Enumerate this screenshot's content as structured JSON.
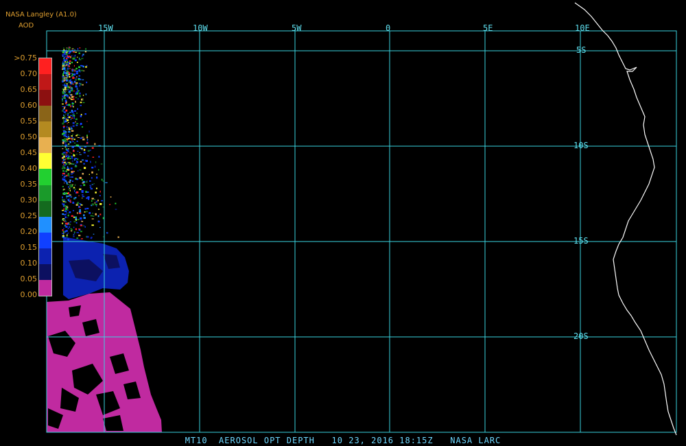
{
  "header": {
    "source": "NASA Langley (A1.0)",
    "product": "AOD"
  },
  "legend": {
    "labels": [
      ">0.75",
      "0.70",
      "0.65",
      "0.60",
      "0.55",
      "0.50",
      "0.45",
      "0.40",
      "0.35",
      "0.30",
      "0.25",
      "0.20",
      "0.15",
      "0.10",
      "0.05",
      "0.00"
    ],
    "colors": [
      "#ff2020",
      "#c01818",
      "#8c1010",
      "#8a6418",
      "#b48a20",
      "#e8b050",
      "#ffff33",
      "#22d030",
      "#1a9a2a",
      "#146a1e",
      "#2090ff",
      "#1040ff",
      "#0c22b0",
      "#0c1060",
      "#c02aa0"
    ]
  },
  "grid": {
    "longitudes": [
      "15W",
      "10W",
      "5W",
      "0",
      "5E",
      "10E"
    ],
    "latitudes": [
      "5S",
      "10S",
      "15S",
      "20S"
    ],
    "line_color": "#3ad4e0"
  },
  "footer": {
    "caption": "MT10  AEROSOL OPT DEPTH   10 23, 2016 18:15Z   NASA LARC"
  },
  "colors": {
    "background": "#000000",
    "label_orange": "#e0a030",
    "coast": "#ffffff",
    "aod_low_magenta": "#c02aa0",
    "aod_dark_blue": "#0c22b0"
  }
}
